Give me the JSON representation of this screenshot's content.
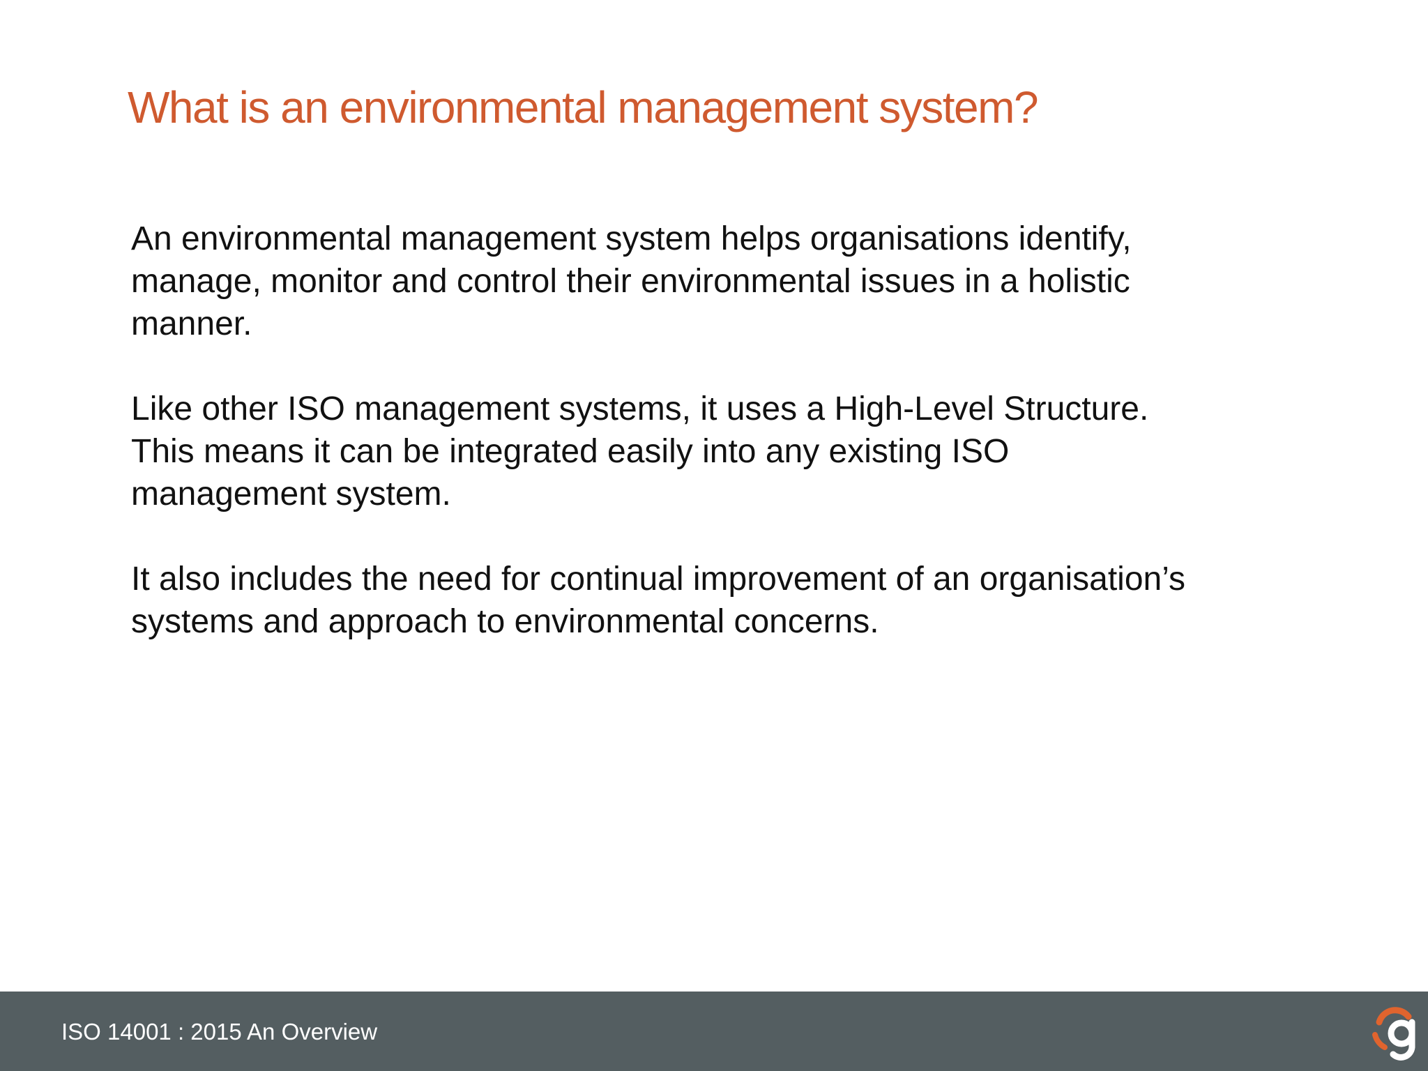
{
  "slide": {
    "title": "What is an environmental management system?",
    "paragraphs": [
      {
        "lines": [
          "An environmental management system helps organisations identify,",
          "manage, monitor and control their environmental issues in a holistic",
          "manner."
        ]
      },
      {
        "lines": [
          "Like other ISO management systems, it uses a High-Level Structure.",
          "This means it can be integrated easily into any existing ISO",
          "management system."
        ]
      },
      {
        "lines": [
          "It also includes the need for continual improvement of an organisation’s",
          "systems and approach to environmental concerns."
        ]
      }
    ]
  },
  "footer": {
    "text": "ISO 14001 : 2015 An Overview",
    "logo_icon": "g-logo-icon"
  },
  "colors": {
    "title": "#cf5a2f",
    "footer_bg": "#545e61",
    "logo_orange": "#e0642e"
  }
}
